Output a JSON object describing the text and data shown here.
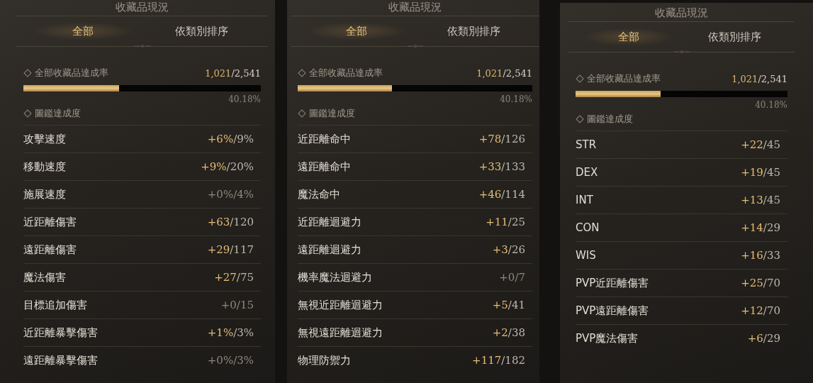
{
  "panels": [
    {
      "title": "收藏品現況",
      "tabs": [
        {
          "label": "全部",
          "selected": true
        },
        {
          "label": "依類別排序",
          "selected": false
        }
      ],
      "total": {
        "label": "全部收藏品達成率",
        "count": "1,021",
        "max": "/2,541",
        "level": 0.4018,
        "percent": "40.18%"
      },
      "section": "圖鑑達成度",
      "stats": [
        {
          "name": "攻擊速度",
          "bonus": "+6%",
          "max": "/9%",
          "active": true
        },
        {
          "name": "移動速度",
          "bonus": "+9%",
          "max": "/20%",
          "active": true
        },
        {
          "name": "施展速度",
          "bonus": "+0%",
          "max": "/4%",
          "active": false
        },
        {
          "name": "近距離傷害",
          "bonus": "+63",
          "max": "/120",
          "active": true
        },
        {
          "name": "遠距離傷害",
          "bonus": "+29",
          "max": "/117",
          "active": true
        },
        {
          "name": "魔法傷害",
          "bonus": "+27",
          "max": "/75",
          "active": true
        },
        {
          "name": "目標追加傷害",
          "bonus": "+0",
          "max": "/15",
          "active": false
        },
        {
          "name": "近距離暴擊傷害",
          "bonus": "+1%",
          "max": "/3%",
          "active": true
        },
        {
          "name": "遠距離暴擊傷害",
          "bonus": "+0%",
          "max": "/3%",
          "active": false
        }
      ]
    },
    {
      "title": "收藏品現況",
      "tabs": [
        {
          "label": "全部",
          "selected": true
        },
        {
          "label": "依類別排序",
          "selected": false
        }
      ],
      "total": {
        "label": "全部收藏品達成率",
        "count": "1,021",
        "max": "/2,541",
        "level": 0.4018,
        "percent": "40.18%"
      },
      "section": "圖鑑達成度",
      "stats": [
        {
          "name": "近距離命中",
          "bonus": "+78",
          "max": "/126",
          "active": true
        },
        {
          "name": "遠距離命中",
          "bonus": "+33",
          "max": "/133",
          "active": true
        },
        {
          "name": "魔法命中",
          "bonus": "+46",
          "max": "/114",
          "active": true
        },
        {
          "name": "近距離迴避力",
          "bonus": "+11",
          "max": "/25",
          "active": true
        },
        {
          "name": "遠距離迴避力",
          "bonus": "+3",
          "max": "/26",
          "active": true
        },
        {
          "name": "機率魔法迴避力",
          "bonus": "+0",
          "max": "/7",
          "active": false
        },
        {
          "name": "無視近距離迴避力",
          "bonus": "+5",
          "max": "/41",
          "active": true
        },
        {
          "name": "無視遠距離迴避力",
          "bonus": "+2",
          "max": "/38",
          "active": true
        },
        {
          "name": "物理防禦力",
          "bonus": "+117",
          "max": "/182",
          "active": true
        }
      ]
    },
    {
      "title": "收藏品現況",
      "tabs": [
        {
          "label": "全部",
          "selected": true
        },
        {
          "label": "依類別排序",
          "selected": false
        }
      ],
      "total": {
        "label": "全部收藏品達成率",
        "count": "1,021",
        "max": "/2,541",
        "level": 0.4018,
        "percent": "40.18%"
      },
      "section": "圖鑑達成度",
      "stats": [
        {
          "name": "STR",
          "bonus": "+22",
          "max": "/45",
          "active": true
        },
        {
          "name": "DEX",
          "bonus": "+19",
          "max": "/45",
          "active": true
        },
        {
          "name": "INT",
          "bonus": "+13",
          "max": "/45",
          "active": true
        },
        {
          "name": "CON",
          "bonus": "+14",
          "max": "/29",
          "active": true
        },
        {
          "name": "WIS",
          "bonus": "+16",
          "max": "/33",
          "active": true
        },
        {
          "name": "PVP近距離傷害",
          "bonus": "+25",
          "max": "/70",
          "active": true
        },
        {
          "name": "PVP遠距離傷害",
          "bonus": "+12",
          "max": "/70",
          "active": true
        },
        {
          "name": "PVP魔法傷害",
          "bonus": "+6",
          "max": "/29",
          "active": true
        }
      ]
    }
  ]
}
